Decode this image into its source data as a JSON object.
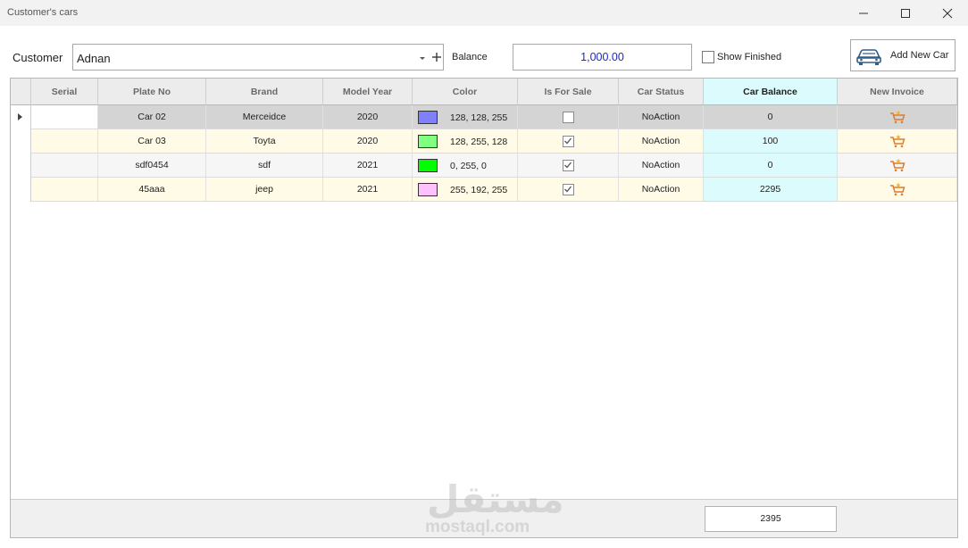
{
  "window": {
    "title": "Customer's cars"
  },
  "toolbar": {
    "customer_label": "Customer",
    "customer_value": "Adnan",
    "balance_label": "Balance",
    "balance_value": "1,000.00",
    "show_finished_label": "Show Finished",
    "show_finished_checked": false,
    "add_car_label": "Add New Car"
  },
  "grid": {
    "columns": [
      "Serial",
      "Plate No",
      "Brand",
      "Model Year",
      "Color",
      "Is For Sale",
      "Car Status",
      "Car Balance",
      "New Invoice"
    ],
    "rows": [
      {
        "serial": "",
        "plate": "Car 02",
        "brand": "Merceidce",
        "year": "2020",
        "color_hex": "#8080ff",
        "color_text": "128, 128, 255",
        "for_sale": false,
        "status": "NoAction",
        "balance": "0"
      },
      {
        "serial": "",
        "plate": "Car 03",
        "brand": "Toyta",
        "year": "2020",
        "color_hex": "#80ff80",
        "color_text": "128, 255, 128",
        "for_sale": true,
        "status": "NoAction",
        "balance": "100"
      },
      {
        "serial": "",
        "plate": "sdf0454",
        "brand": "sdf",
        "year": "2021",
        "color_hex": "#00ff00",
        "color_text": "0, 255, 0",
        "for_sale": true,
        "status": "NoAction",
        "balance": "0"
      },
      {
        "serial": "",
        "plate": "45aaa",
        "brand": "jeep",
        "year": "2021",
        "color_hex": "#ffc0ff",
        "color_text": "255, 192, 255",
        "for_sale": true,
        "status": "NoAction",
        "balance": "2295"
      }
    ],
    "total_balance": "2395"
  },
  "colors": {
    "row_selected": "#d4d4d4",
    "row_alt": "#fffbe6",
    "row_plain": "#f6f6f6",
    "car_balance_column": "#dcfbfd",
    "balance_text": "#1e27c4",
    "invoice_icon": "#e07b2c"
  },
  "watermark": {
    "arabic": "مستقل",
    "latin": "mostaql.com"
  }
}
